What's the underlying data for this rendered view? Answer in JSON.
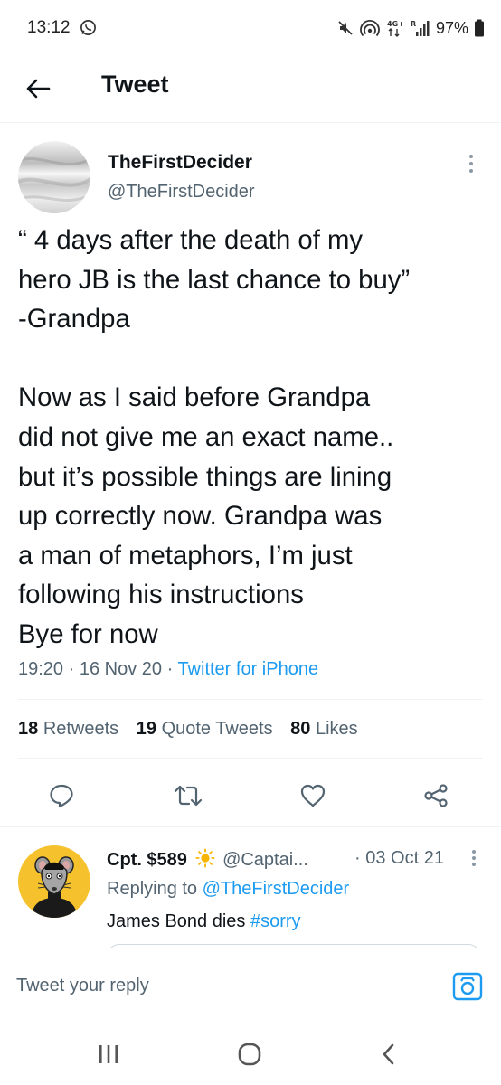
{
  "status_bar": {
    "time": "13:12",
    "battery_percent": "97%",
    "icons": [
      "whatsapp-icon",
      "mute-icon",
      "hotspot-icon",
      "4g-icon",
      "signal-icon",
      "battery-icon"
    ]
  },
  "header": {
    "back_icon": "arrow-left-icon",
    "title": "Tweet"
  },
  "tweet": {
    "author_name": "TheFirstDecider",
    "author_handle": "@TheFirstDecider",
    "body_lines": [
      "“ 4 days after the death of my",
      "hero JB is the last chance to buy”",
      "-Grandpa",
      "",
      "Now as I said before Grandpa",
      "did not give me an exact name..",
      "but it’s possible things are lining",
      "up correctly now. Grandpa was",
      "a man of metaphors, I’m just",
      "following his instructions",
      "Bye for now"
    ],
    "time": "19:20",
    "date": "16 Nov 20",
    "source": "Twitter for iPhone",
    "stats": {
      "retweets_count": "18",
      "retweets_label": "Retweets",
      "quotes_count": "19",
      "quotes_label": "Quote Tweets",
      "likes_count": "80",
      "likes_label": "Likes"
    },
    "actions": [
      "reply-icon",
      "retweet-icon",
      "like-icon",
      "share-icon"
    ]
  },
  "reply": {
    "author_name": "Cpt. $589",
    "author_handle": "@Captai...",
    "date": "· 03 Oct 21",
    "replying_prefix": "Replying to",
    "replying_to": "@TheFirstDecider",
    "text": "James Bond dies",
    "hashtag": "#sorry"
  },
  "compose": {
    "placeholder": "Tweet your reply"
  },
  "colors": {
    "accent": "#1d9bf0",
    "text_primary": "#0f1419",
    "text_secondary": "#536471",
    "divider": "#eff3f4",
    "reply_avatar_bg": "#f5c12c"
  }
}
